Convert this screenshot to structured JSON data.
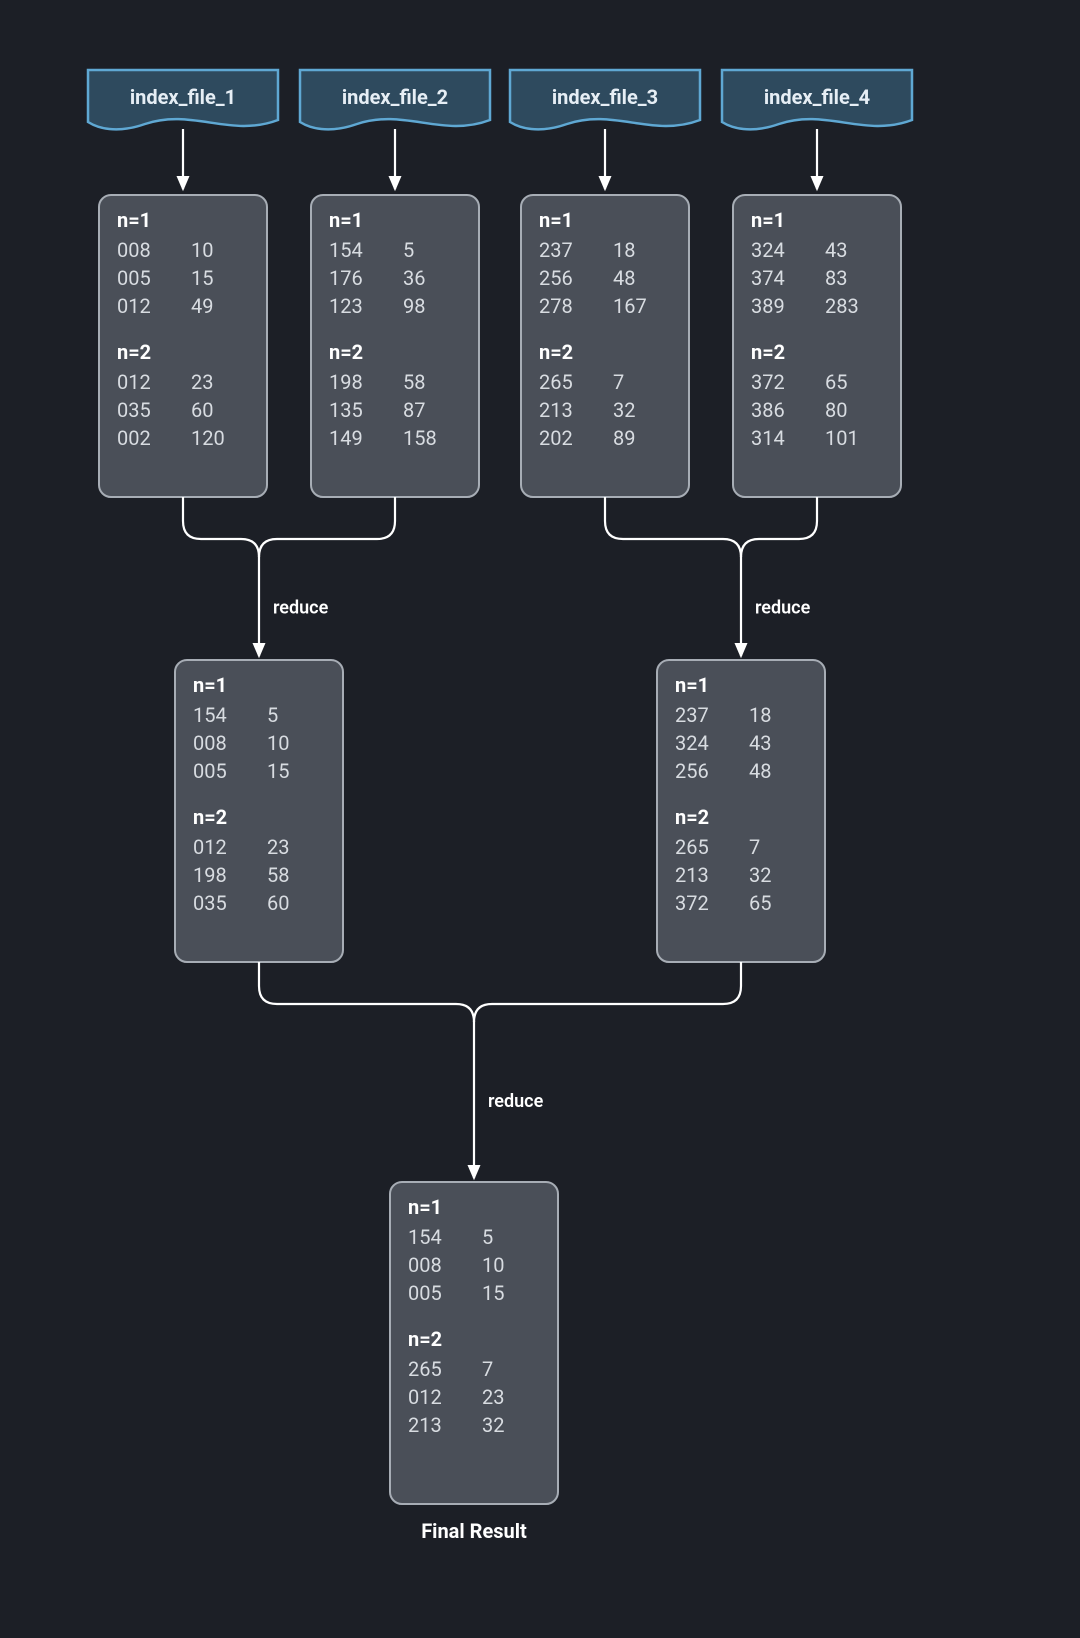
{
  "files": [
    {
      "id": "f1",
      "label": "index_file_1"
    },
    {
      "id": "f2",
      "label": "index_file_2"
    },
    {
      "id": "f3",
      "label": "index_file_3"
    },
    {
      "id": "f4",
      "label": "index_file_4"
    }
  ],
  "level1_boxes": [
    {
      "id": "b1",
      "sections": [
        {
          "header": "n=1",
          "rows": [
            [
              "008",
              "10"
            ],
            [
              "005",
              "15"
            ],
            [
              "012",
              "49"
            ]
          ]
        },
        {
          "header": "n=2",
          "rows": [
            [
              "012",
              "23"
            ],
            [
              "035",
              "60"
            ],
            [
              "002",
              "120"
            ]
          ]
        }
      ]
    },
    {
      "id": "b2",
      "sections": [
        {
          "header": "n=1",
          "rows": [
            [
              "154",
              "5"
            ],
            [
              "176",
              "36"
            ],
            [
              "123",
              "98"
            ]
          ]
        },
        {
          "header": "n=2",
          "rows": [
            [
              "198",
              "58"
            ],
            [
              "135",
              "87"
            ],
            [
              "149",
              "158"
            ]
          ]
        }
      ]
    },
    {
      "id": "b3",
      "sections": [
        {
          "header": "n=1",
          "rows": [
            [
              "237",
              "18"
            ],
            [
              "256",
              "48"
            ],
            [
              "278",
              "167"
            ]
          ]
        },
        {
          "header": "n=2",
          "rows": [
            [
              "265",
              "7"
            ],
            [
              "213",
              "32"
            ],
            [
              "202",
              "89"
            ]
          ]
        }
      ]
    },
    {
      "id": "b4",
      "sections": [
        {
          "header": "n=1",
          "rows": [
            [
              "324",
              "43"
            ],
            [
              "374",
              "83"
            ],
            [
              "389",
              "283"
            ]
          ]
        },
        {
          "header": "n=2",
          "rows": [
            [
              "372",
              "65"
            ],
            [
              "386",
              "80"
            ],
            [
              "314",
              "101"
            ]
          ]
        }
      ]
    }
  ],
  "level2_boxes": [
    {
      "id": "r1",
      "sections": [
        {
          "header": "n=1",
          "rows": [
            [
              "154",
              "5"
            ],
            [
              "008",
              "10"
            ],
            [
              "005",
              "15"
            ]
          ]
        },
        {
          "header": "n=2",
          "rows": [
            [
              "012",
              "23"
            ],
            [
              "198",
              "58"
            ],
            [
              "035",
              "60"
            ]
          ]
        }
      ]
    },
    {
      "id": "r2",
      "sections": [
        {
          "header": "n=1",
          "rows": [
            [
              "237",
              "18"
            ],
            [
              "324",
              "43"
            ],
            [
              "256",
              "48"
            ]
          ]
        },
        {
          "header": "n=2",
          "rows": [
            [
              "265",
              "7"
            ],
            [
              "213",
              "32"
            ],
            [
              "372",
              "65"
            ]
          ]
        }
      ]
    }
  ],
  "level3_box": {
    "id": "final",
    "sections": [
      {
        "header": "n=1",
        "rows": [
          [
            "154",
            "5"
          ],
          [
            "008",
            "10"
          ],
          [
            "005",
            "15"
          ]
        ]
      },
      {
        "header": "n=2",
        "rows": [
          [
            "265",
            "7"
          ],
          [
            "012",
            "23"
          ],
          [
            "213",
            "32"
          ]
        ]
      }
    ]
  },
  "edge_labels": {
    "reduce_left": "reduce",
    "reduce_right": "reduce",
    "reduce_final": "reduce"
  },
  "final_label": "Final Result",
  "colors": {
    "bg": "#1c1f26",
    "file_fill": "#2e4a5e",
    "file_stroke": "#5fa8d3",
    "box_fill": "#4a4f58",
    "box_stroke": "#a7adb5",
    "edge": "#ffffff"
  }
}
